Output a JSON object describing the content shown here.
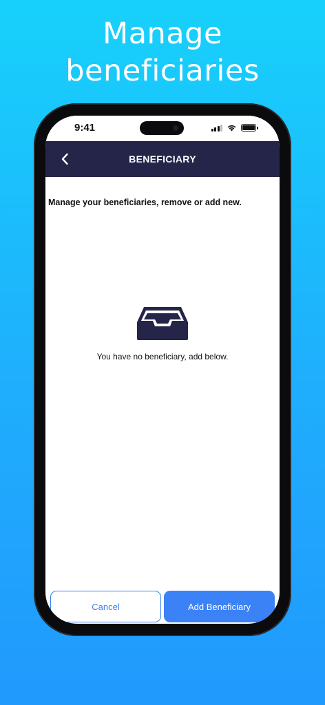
{
  "headline": {
    "line1": "Manage",
    "line2": "beneficiaries"
  },
  "status_bar": {
    "time": "9:41"
  },
  "navbar": {
    "title": "BENEFICIARY",
    "back_icon": "chevron-left-icon"
  },
  "content": {
    "intro": "Manage your beneficiaries, remove or add new.",
    "empty_icon": "empty-inbox-tray-icon",
    "empty_message": "You have no beneficiary, add below."
  },
  "actions": {
    "cancel_label": "Cancel",
    "add_label": "Add Beneficiary"
  },
  "colors": {
    "navbar": "#25254a",
    "accent": "#3b82f6",
    "icon": "#25254a"
  }
}
